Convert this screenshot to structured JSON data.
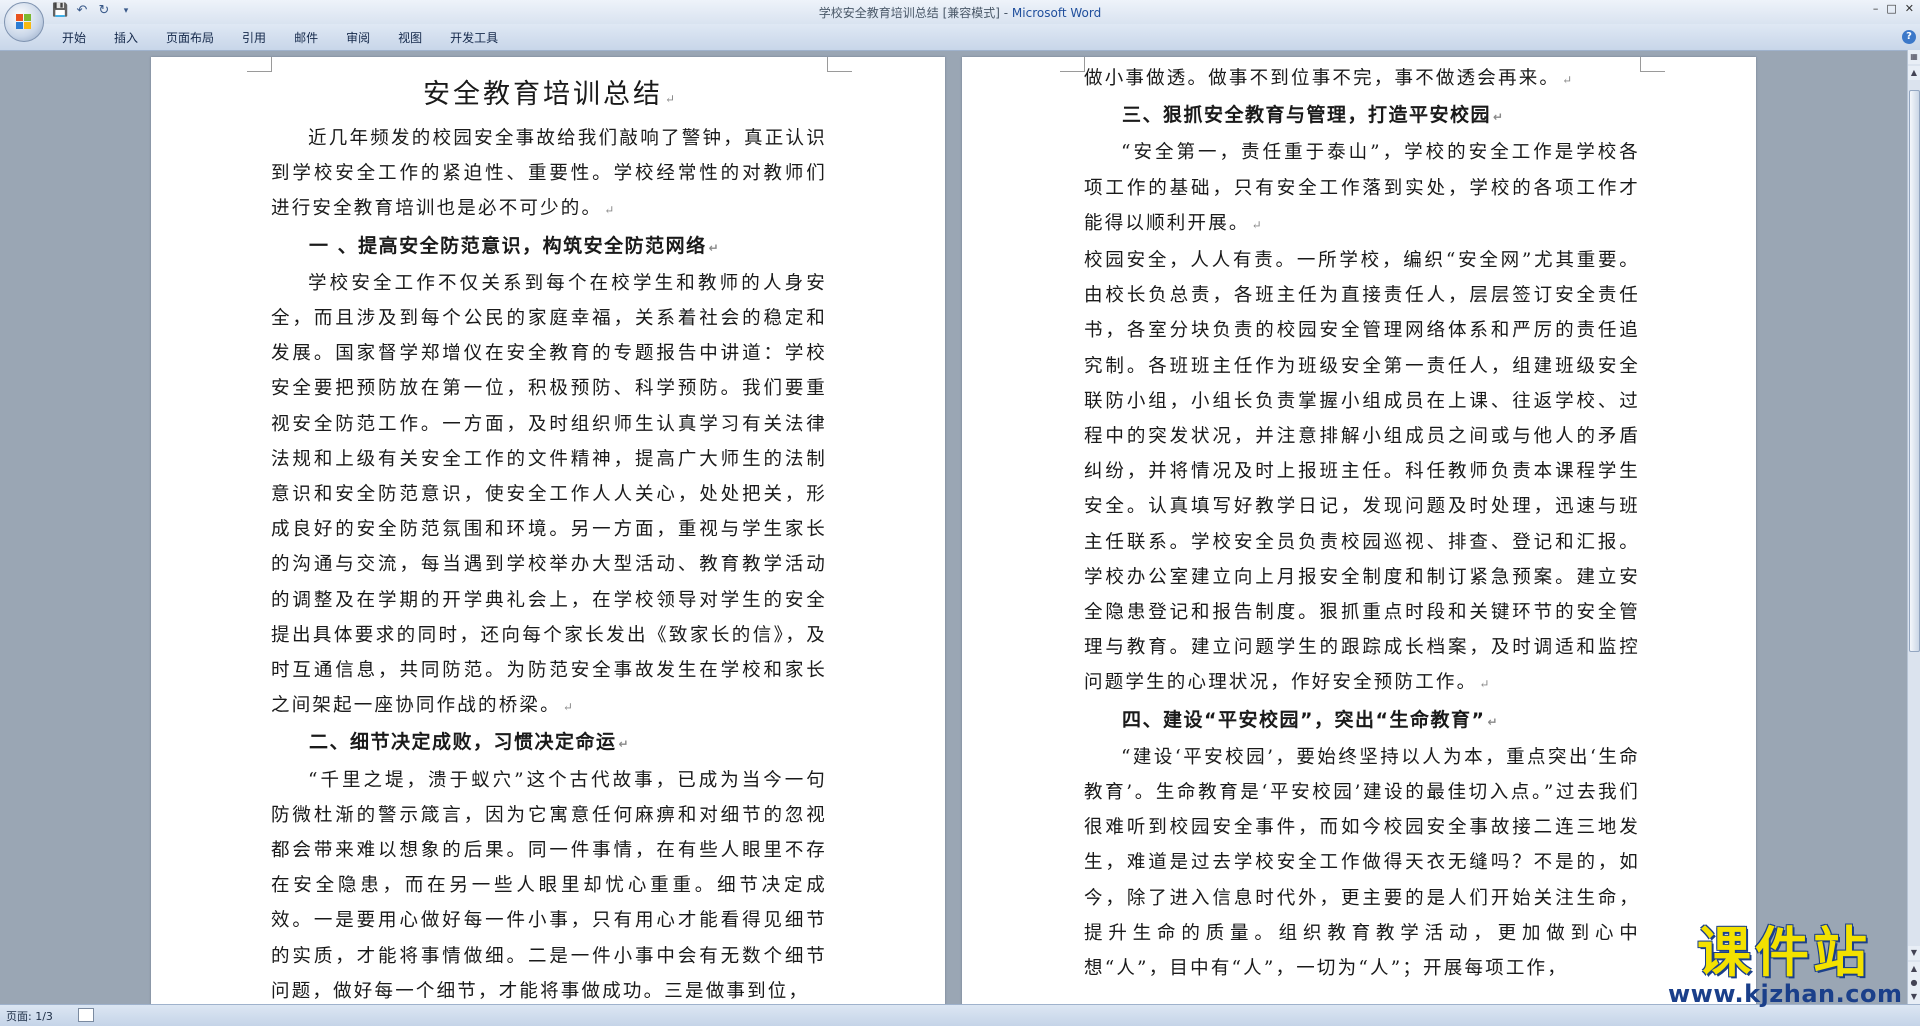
{
  "window": {
    "doc_title": "学校安全教育培训总结 [兼容模式] - ",
    "app_name": "Microsoft Word"
  },
  "menu": {
    "tabs": [
      "开始",
      "插入",
      "页面布局",
      "引用",
      "邮件",
      "审阅",
      "视图",
      "开发工具"
    ]
  },
  "page1": {
    "title": "安全教育培训总结",
    "intro": "近几年频发的校园安全事故给我们敲响了警钟，真正认识到学校安全工作的紧迫性、重要性。学校经常性的对教师们进行安全教育培训也是必不可少的。",
    "h1": "一 、提高安全防范意识，构筑安全防范网络",
    "p1": "学校安全工作不仅关系到每个在校学生和教师的人身安全，而且涉及到每个公民的家庭幸福，关系着社会的稳定和发展。国家督学郑增仪在安全教育的专题报告中讲道：学校安全要把预防放在第一位，积极预防、科学预防。我们要重视安全防范工作。一方面，及时组织师生认真学习有关法律法规和上级有关安全工作的文件精神，提高广大师生的法制意识和安全防范意识，使安全工作人人关心，处处把关，形成良好的安全防范氛围和环境。另一方面，重视与学生家长的沟通与交流，每当遇到学校举办大型活动、教育教学活动的调整及在学期的开学典礼会上，在学校领导对学生的安全提出具体要求的同时，还向每个家长发出《致家长的信》，及时互通信息，共同防范。为防范安全事故发生在学校和家长之间架起一座协同作战的桥梁。",
    "h2": "二、细节决定成败，习惯决定命运",
    "p2": "“千里之堤，溃于蚁穴”这个古代故事，已成为当今一句防微杜渐的警示箴言，因为它寓意任何麻痹和对细节的忽视都会带来难以想象的后果。同一件事情，在有些人眼里不存在安全隐患，而在另一些人眼里却忧心重重。细节决定成效。一是要用心做好每一件小事，只有用心才能看得见细节的实质，才能将事情做细。二是一件小事中会有无数个细节问题，做好每一个细节，才能将事做成功。三是做事到位，"
  },
  "page2": {
    "p0": "做小事做透。做事不到位事不完，事不做透会再来。",
    "h3": "三、狠抓安全教育与管理，打造平安校园",
    "p3a": "“安全第一，责任重于泰山”，学校的安全工作是学校各项工作的基础，只有安全工作落到实处，学校的各项工作才能得以顺利开展。",
    "p3b": "校园安全，人人有责。一所学校，编织“安全网”尤其重要。由校长负总责，各班主任为直接责任人，层层签订安全责任书，各室分块负责的校园安全管理网络体系和严厉的责任追究制。各班班主任作为班级安全第一责任人，组建班级安全联防小组，小组长负责掌握小组成员在上课、往返学校、过程中的突发状况，并注意排解小组成员之间或与他人的矛盾纠纷，并将情况及时上报班主任。科任教师负责本课程学生安全。认真填写好教学日记，发现问题及时处理，迅速与班主任联系。学校安全员负责校园巡视、排查、登记和汇报。学校办公室建立向上月报安全制度和制订紧急预案。建立安全隐患登记和报告制度。狠抓重点时段和关键环节的安全管理与教育。建立问题学生的跟踪成长档案，及时调适和监控问题学生的心理状况，作好安全预防工作。",
    "h4": "四、建设“平安校园”，突出“生命教育”",
    "p4": "“建设‘平安校园’，要始终坚持以人为本，重点突出‘生命教育’。生命教育是‘平安校园’建设的最佳切入点。”过去我们很难听到校园安全事件，而如今校园安全事故接二连三地发生，难道是过去学校安全工作做得天衣无缝吗？不是的，如今，除了进入信息时代外，更主要的是人们开始关注生命，提升生命的质量。组织教育教学活动，更加做到心中想“人”，目中有“人”，一切为“人”；开展每项工作，"
  },
  "status": {
    "page": "页面: 1/3"
  },
  "watermark": {
    "big": "课件站",
    "url": "www.kjzhan.com"
  },
  "colors": {
    "accent": "#1f4e9c",
    "background": "#9aa6b4",
    "watermark_yellow": "#f3e100"
  }
}
